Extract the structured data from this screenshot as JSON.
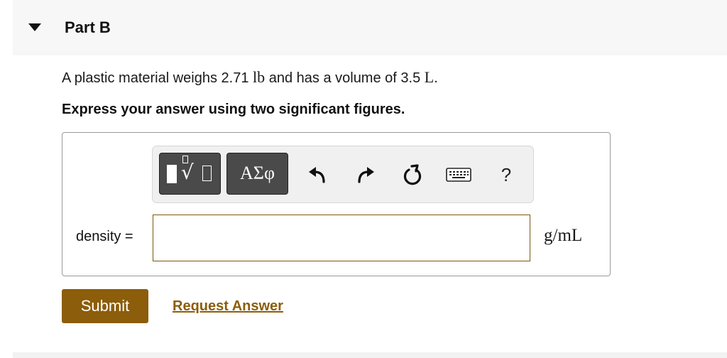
{
  "part": {
    "title": "Part B"
  },
  "question": {
    "text_before": "A plastic material weighs 2.71 ",
    "unit1": "lb",
    "text_middle": " and has a volume of 3.5 ",
    "unit2": "L",
    "text_after": ".",
    "instruction": "Express your answer using two significant figures."
  },
  "toolbar": {
    "greek_label": "ΑΣφ",
    "help_label": "?",
    "icons": [
      "templates-icon",
      "greek-letters-icon",
      "undo-icon",
      "redo-icon",
      "reset-icon",
      "keyboard-icon",
      "help-icon"
    ]
  },
  "answer": {
    "label": "density =",
    "value": "",
    "unit": "g/mL"
  },
  "actions": {
    "submit_label": "Submit",
    "request_label": "Request Answer"
  },
  "colors": {
    "accent": "#8c5d0a",
    "input_border": "#7a5a0e",
    "toolbar_button": "#4a4a4a"
  }
}
